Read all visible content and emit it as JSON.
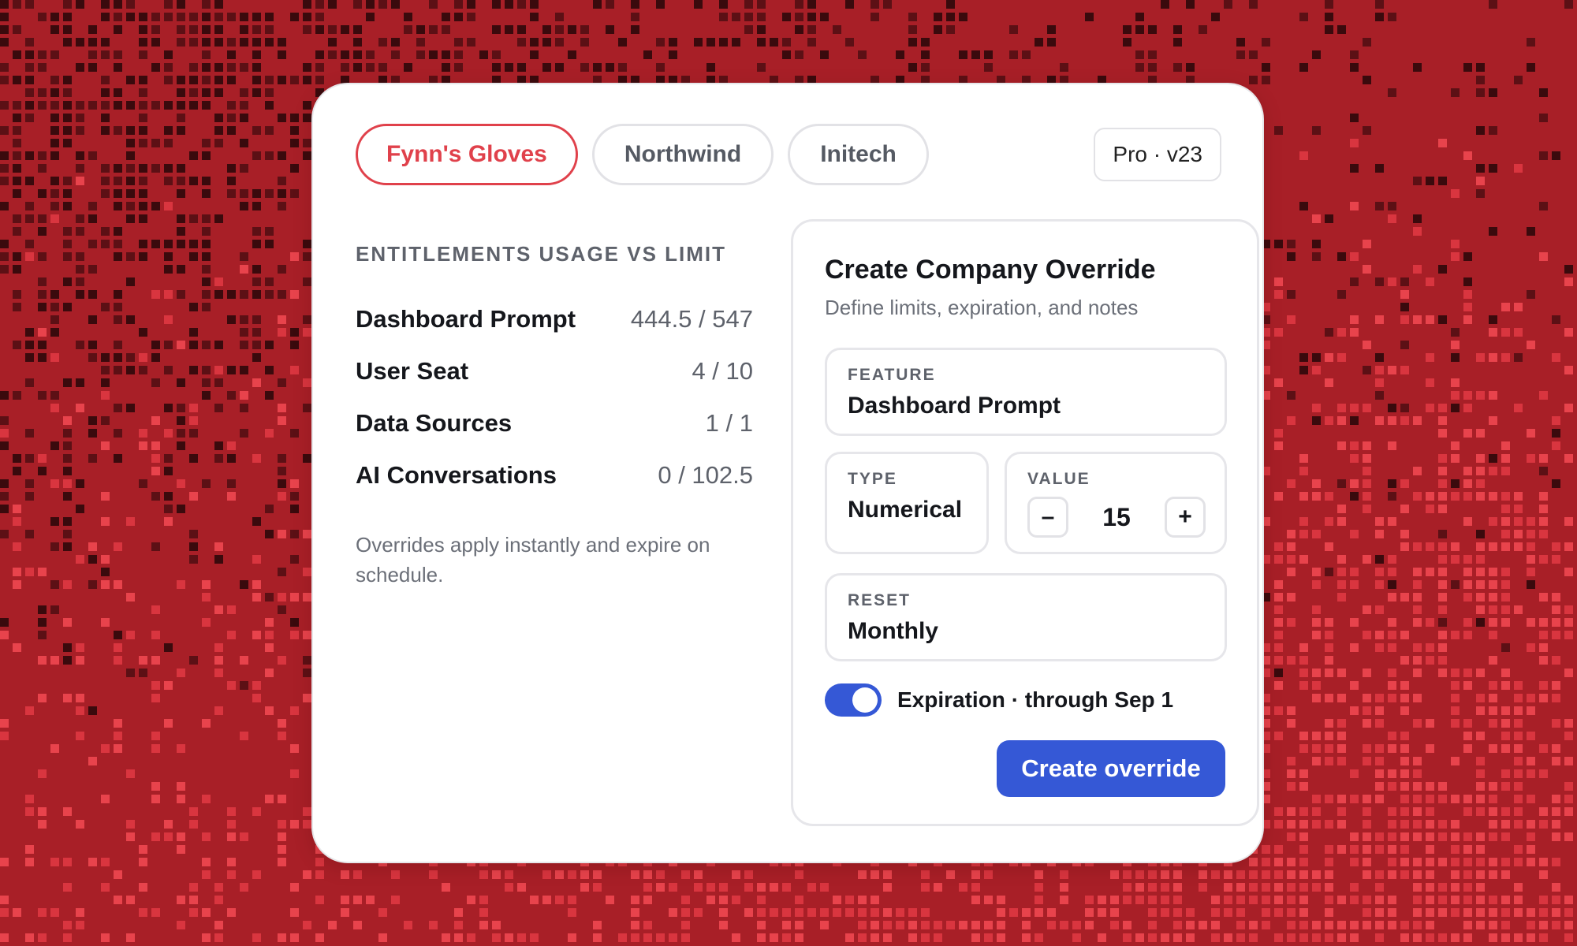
{
  "colors": {
    "background": "#a81f27",
    "accent_red": "#e0414b",
    "primary_blue": "#3558d6"
  },
  "tabs": [
    {
      "label": "Fynn's Gloves",
      "active": true
    },
    {
      "label": "Northwind",
      "active": false
    },
    {
      "label": "Initech",
      "active": false
    }
  ],
  "plan_badge": "Pro · v23",
  "usage": {
    "title": "ENTITLEMENTS USAGE VS LIMIT",
    "rows": [
      {
        "name": "Dashboard Prompt",
        "value": "444.5 / 547"
      },
      {
        "name": "User Seat",
        "value": "4 / 10"
      },
      {
        "name": "Data Sources",
        "value": "1 / 1"
      },
      {
        "name": "AI Conversations",
        "value": "0 / 102.5"
      }
    ],
    "note": "Overrides apply instantly and expire on schedule."
  },
  "override": {
    "title": "Create Company Override",
    "subtitle": "Define limits, expiration, and notes",
    "feature": {
      "label": "FEATURE",
      "value": "Dashboard Prompt"
    },
    "type": {
      "label": "TYPE",
      "value": "Numerical"
    },
    "value": {
      "label": "VALUE",
      "amount": "15",
      "decrement": "–",
      "increment": "+"
    },
    "reset": {
      "label": "RESET",
      "value": "Monthly"
    },
    "expiration": {
      "enabled": true,
      "label": "Expiration · through Sep 1"
    },
    "submit_label": "Create override"
  }
}
